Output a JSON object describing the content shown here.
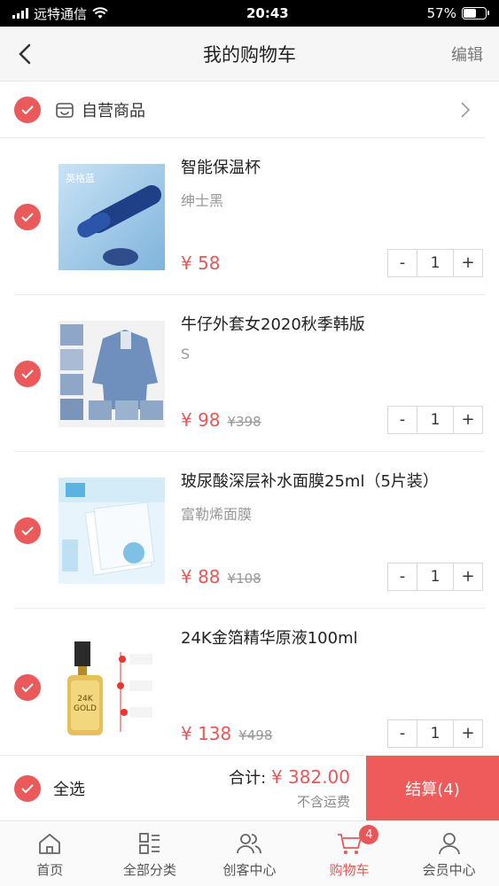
{
  "status_bar": {
    "carrier": "远特通信",
    "time": "20:43",
    "battery": "57%",
    "battery_level": 0.57
  },
  "header": {
    "title": "我的购物车",
    "edit_label": "编辑"
  },
  "shop": {
    "name": "自营商品"
  },
  "items": [
    {
      "name": "智能保温杯",
      "spec": "绅士黑",
      "price": "¥ 58",
      "old_price": "",
      "qty": "1",
      "image_label": "英格蓝",
      "checked": true
    },
    {
      "name": "牛仔外套女2020秋季韩版",
      "spec": "S",
      "price": "¥ 98",
      "old_price": "¥398",
      "qty": "1",
      "checked": true
    },
    {
      "name": "玻尿酸深层补水面膜25ml（5片装）",
      "spec": "富勒烯面膜",
      "price": "¥ 88",
      "old_price": "¥108",
      "qty": "1",
      "checked": true
    },
    {
      "name": "24K金箔精华原液100ml",
      "spec": "",
      "price": "¥ 138",
      "old_price": "¥498",
      "qty": "1",
      "image_label": "24K GOLD",
      "checked": true
    }
  ],
  "stepper": {
    "minus": "-",
    "plus": "+"
  },
  "checkout": {
    "select_all": "全选",
    "total_label": "合计:",
    "total_amount": "¥ 382.00",
    "shipping_note": "不含运费",
    "pay_label": "结算(4)"
  },
  "tabs": [
    {
      "label": "首页",
      "icon": "home-icon"
    },
    {
      "label": "全部分类",
      "icon": "category-icon"
    },
    {
      "label": "创客中心",
      "icon": "users-icon"
    },
    {
      "label": "购物车",
      "icon": "cart-icon",
      "active": true,
      "badge": "4"
    },
    {
      "label": "会员中心",
      "icon": "user-icon"
    }
  ],
  "colors": {
    "accent": "#e85757",
    "checkbox": "#eb5a5a",
    "pay_button": "#ef5b5b"
  }
}
